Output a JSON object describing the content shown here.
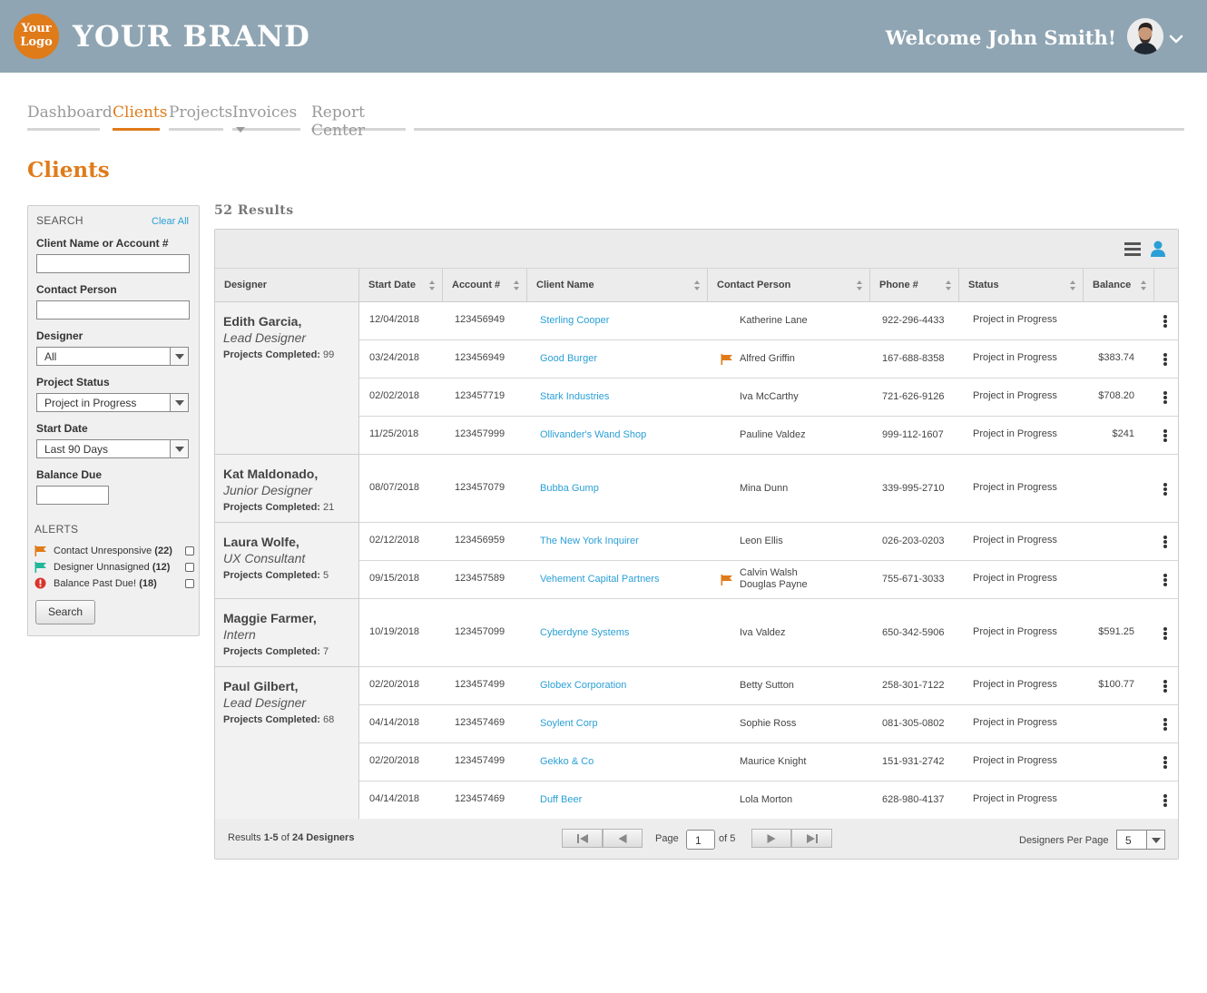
{
  "header": {
    "logo_line1": "Your",
    "logo_line2": "Logo",
    "brand": "YOUR BRAND",
    "welcome": "Welcome John Smith!"
  },
  "nav": {
    "tabs": [
      {
        "label": "Dashboard",
        "active": false
      },
      {
        "label": "Clients",
        "active": true
      },
      {
        "label": "Projects",
        "active": false
      },
      {
        "label": "Invoices",
        "active": false
      },
      {
        "label": "Report Center",
        "active": false
      }
    ]
  },
  "page_title": "Clients",
  "sidebar": {
    "title": "SEARCH",
    "clear_all": "Clear All",
    "client_label": "Client Name or Account #",
    "client_value": "",
    "contact_label": "Contact Person",
    "contact_value": "",
    "designer_label": "Designer",
    "designer_value": "All",
    "status_label": "Project Status",
    "status_value": "Project in Progress",
    "start_label": "Start Date",
    "start_value": "Last 90 Days",
    "balance_label": "Balance Due",
    "balance_value": "",
    "alerts_title": "ALERTS",
    "alerts": [
      {
        "label": "Contact Unresponsive",
        "count": "(22)",
        "icon": "orange-flag-icon"
      },
      {
        "label": "Designer Unnasigned",
        "count": "(12)",
        "icon": "teal-flag-icon"
      },
      {
        "label": "Balance Past Due!",
        "count": "(18)",
        "icon": "red-alert-icon"
      }
    ],
    "search_button": "Search"
  },
  "results_count": "52 Results",
  "table": {
    "headers": {
      "designer": "Designer",
      "start_date": "Start Date",
      "account": "Account #",
      "client_name": "Client Name",
      "contact": "Contact Person",
      "phone": "Phone #",
      "status": "Status",
      "balance": "Balance"
    },
    "projects_label": "Projects Completed:",
    "groups": [
      {
        "name": "Edith Garcia,",
        "role": "Lead Designer",
        "projects": "99",
        "rows": [
          {
            "date": "12/04/2018",
            "account": "123456949",
            "client": "Sterling Cooper",
            "contact": "Katherine Lane",
            "contact2": "",
            "flag": false,
            "phone": "922-296-4433",
            "status": "Project in Progress",
            "balance": ""
          },
          {
            "date": "03/24/2018",
            "account": "123456949",
            "client": "Good Burger",
            "contact": "Alfred Griffin",
            "contact2": "",
            "flag": true,
            "phone": "167-688-8358",
            "status": "Project in Progress",
            "balance": "$383.74"
          },
          {
            "date": "02/02/2018",
            "account": "123457719",
            "client": "Stark Industries",
            "contact": "Iva McCarthy",
            "contact2": "",
            "flag": false,
            "phone": "721-626-9126",
            "status": "Project in Progress",
            "balance": "$708.20"
          },
          {
            "date": "11/25/2018",
            "account": "123457999",
            "client": "Ollivander's Wand Shop",
            "contact": "Pauline Valdez",
            "contact2": "",
            "flag": false,
            "phone": "999-112-1607",
            "status": "Project in Progress",
            "balance": "$241"
          }
        ]
      },
      {
        "name": "Kat Maldonado,",
        "role": "Junior Designer",
        "projects": "21",
        "rows": [
          {
            "date": "08/07/2018",
            "account": "123457079",
            "client": "Bubba Gump",
            "contact": "Mina Dunn",
            "contact2": "",
            "flag": false,
            "phone": "339-995-2710",
            "status": "Project in Progress",
            "balance": ""
          }
        ]
      },
      {
        "name": "Laura Wolfe,",
        "role": "UX Consultant",
        "projects": "5",
        "rows": [
          {
            "date": "02/12/2018",
            "account": "123456959",
            "client": "The New York Inquirer",
            "contact": "Leon Ellis",
            "contact2": "",
            "flag": false,
            "phone": "026-203-0203",
            "status": "Project in Progress",
            "balance": ""
          },
          {
            "date": "09/15/2018",
            "account": "123457589",
            "client": "Vehement Capital Partners",
            "contact": "Calvin Walsh",
            "contact2": "Douglas Payne",
            "flag": true,
            "phone": "755-671-3033",
            "status": "Project in Progress",
            "balance": ""
          }
        ]
      },
      {
        "name": "Maggie Farmer,",
        "role": "Intern",
        "projects": "7",
        "rows": [
          {
            "date": "10/19/2018",
            "account": "123457099",
            "client": "Cyberdyne Systems",
            "contact": "Iva Valdez",
            "contact2": "",
            "flag": false,
            "phone": "650-342-5906",
            "status": "Project in Progress",
            "balance": "$591.25"
          }
        ]
      },
      {
        "name": "Paul Gilbert,",
        "role": "Lead Designer",
        "projects": "68",
        "rows": [
          {
            "date": "02/20/2018",
            "account": "123457499",
            "client": "Globex Corporation",
            "contact": "Betty Sutton",
            "contact2": "",
            "flag": false,
            "phone": "258-301-7122",
            "status": "Project in Progress",
            "balance": "$100.77"
          },
          {
            "date": "04/14/2018",
            "account": "123457469",
            "client": "Soylent Corp",
            "contact": "Sophie Ross",
            "contact2": "",
            "flag": false,
            "phone": "081-305-0802",
            "status": "Project in Progress",
            "balance": ""
          },
          {
            "date": "02/20/2018",
            "account": "123457499",
            "client": "Gekko & Co",
            "contact": "Maurice Knight",
            "contact2": "",
            "flag": false,
            "phone": "151-931-2742",
            "status": "Project in Progress",
            "balance": ""
          },
          {
            "date": "04/14/2018",
            "account": "123457469",
            "client": "Duff Beer",
            "contact": "Lola Morton",
            "contact2": "",
            "flag": false,
            "phone": "628-980-4137",
            "status": "Project in Progress",
            "balance": ""
          }
        ]
      }
    ]
  },
  "footer": {
    "results_prefix": "Results",
    "results_range": "1-5",
    "results_of": "of",
    "results_total": "24 Designers",
    "page_label": "Page",
    "page_value": "1",
    "page_of": "of 5",
    "per_page_label": "Designers Per Page",
    "per_page_value": "5"
  },
  "colors": {
    "brand_orange": "#e07b1a",
    "header_bg": "#8fa5b3",
    "link_blue": "#2a9fd6",
    "teal": "#1fb89a",
    "alert_red": "#d9342b"
  }
}
